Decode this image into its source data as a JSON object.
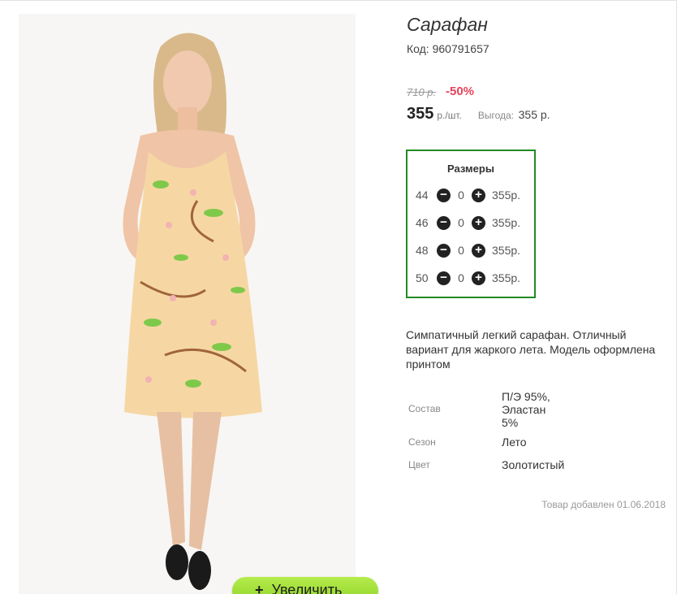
{
  "product": {
    "title": "Сарафан",
    "code": "Код: 960791657",
    "old_price": "710 р.",
    "discount": "-50%",
    "price": "355",
    "price_unit": "р./шт.",
    "benefit_label": "Выгода:",
    "benefit_value": "355 р.",
    "description": "Симпатичный легкий сарафан. Отличный вариант для жаркого лета. Модель оформлена принтом",
    "added": "Товар добавлен 01.06.2018",
    "zoom_label": "Увеличить"
  },
  "sizes": {
    "title": "Размеры",
    "items": [
      {
        "size": "44",
        "qty": "0",
        "price": "355р."
      },
      {
        "size": "46",
        "qty": "0",
        "price": "355р."
      },
      {
        "size": "48",
        "qty": "0",
        "price": "355р."
      },
      {
        "size": "50",
        "qty": "0",
        "price": "355р."
      }
    ]
  },
  "attributes": [
    {
      "label": "Состав",
      "value": "П/Э 95%, Эластан 5%"
    },
    {
      "label": "Сезон",
      "value": "Лето"
    },
    {
      "label": "Цвет",
      "value": "Золотистый"
    }
  ],
  "colors": {
    "accent_green": "#228b22",
    "discount_red": "#e8435a",
    "zoom_button": "#9cdc35"
  },
  "icons": {
    "minus": "minus-circle-icon",
    "plus": "plus-circle-icon"
  }
}
